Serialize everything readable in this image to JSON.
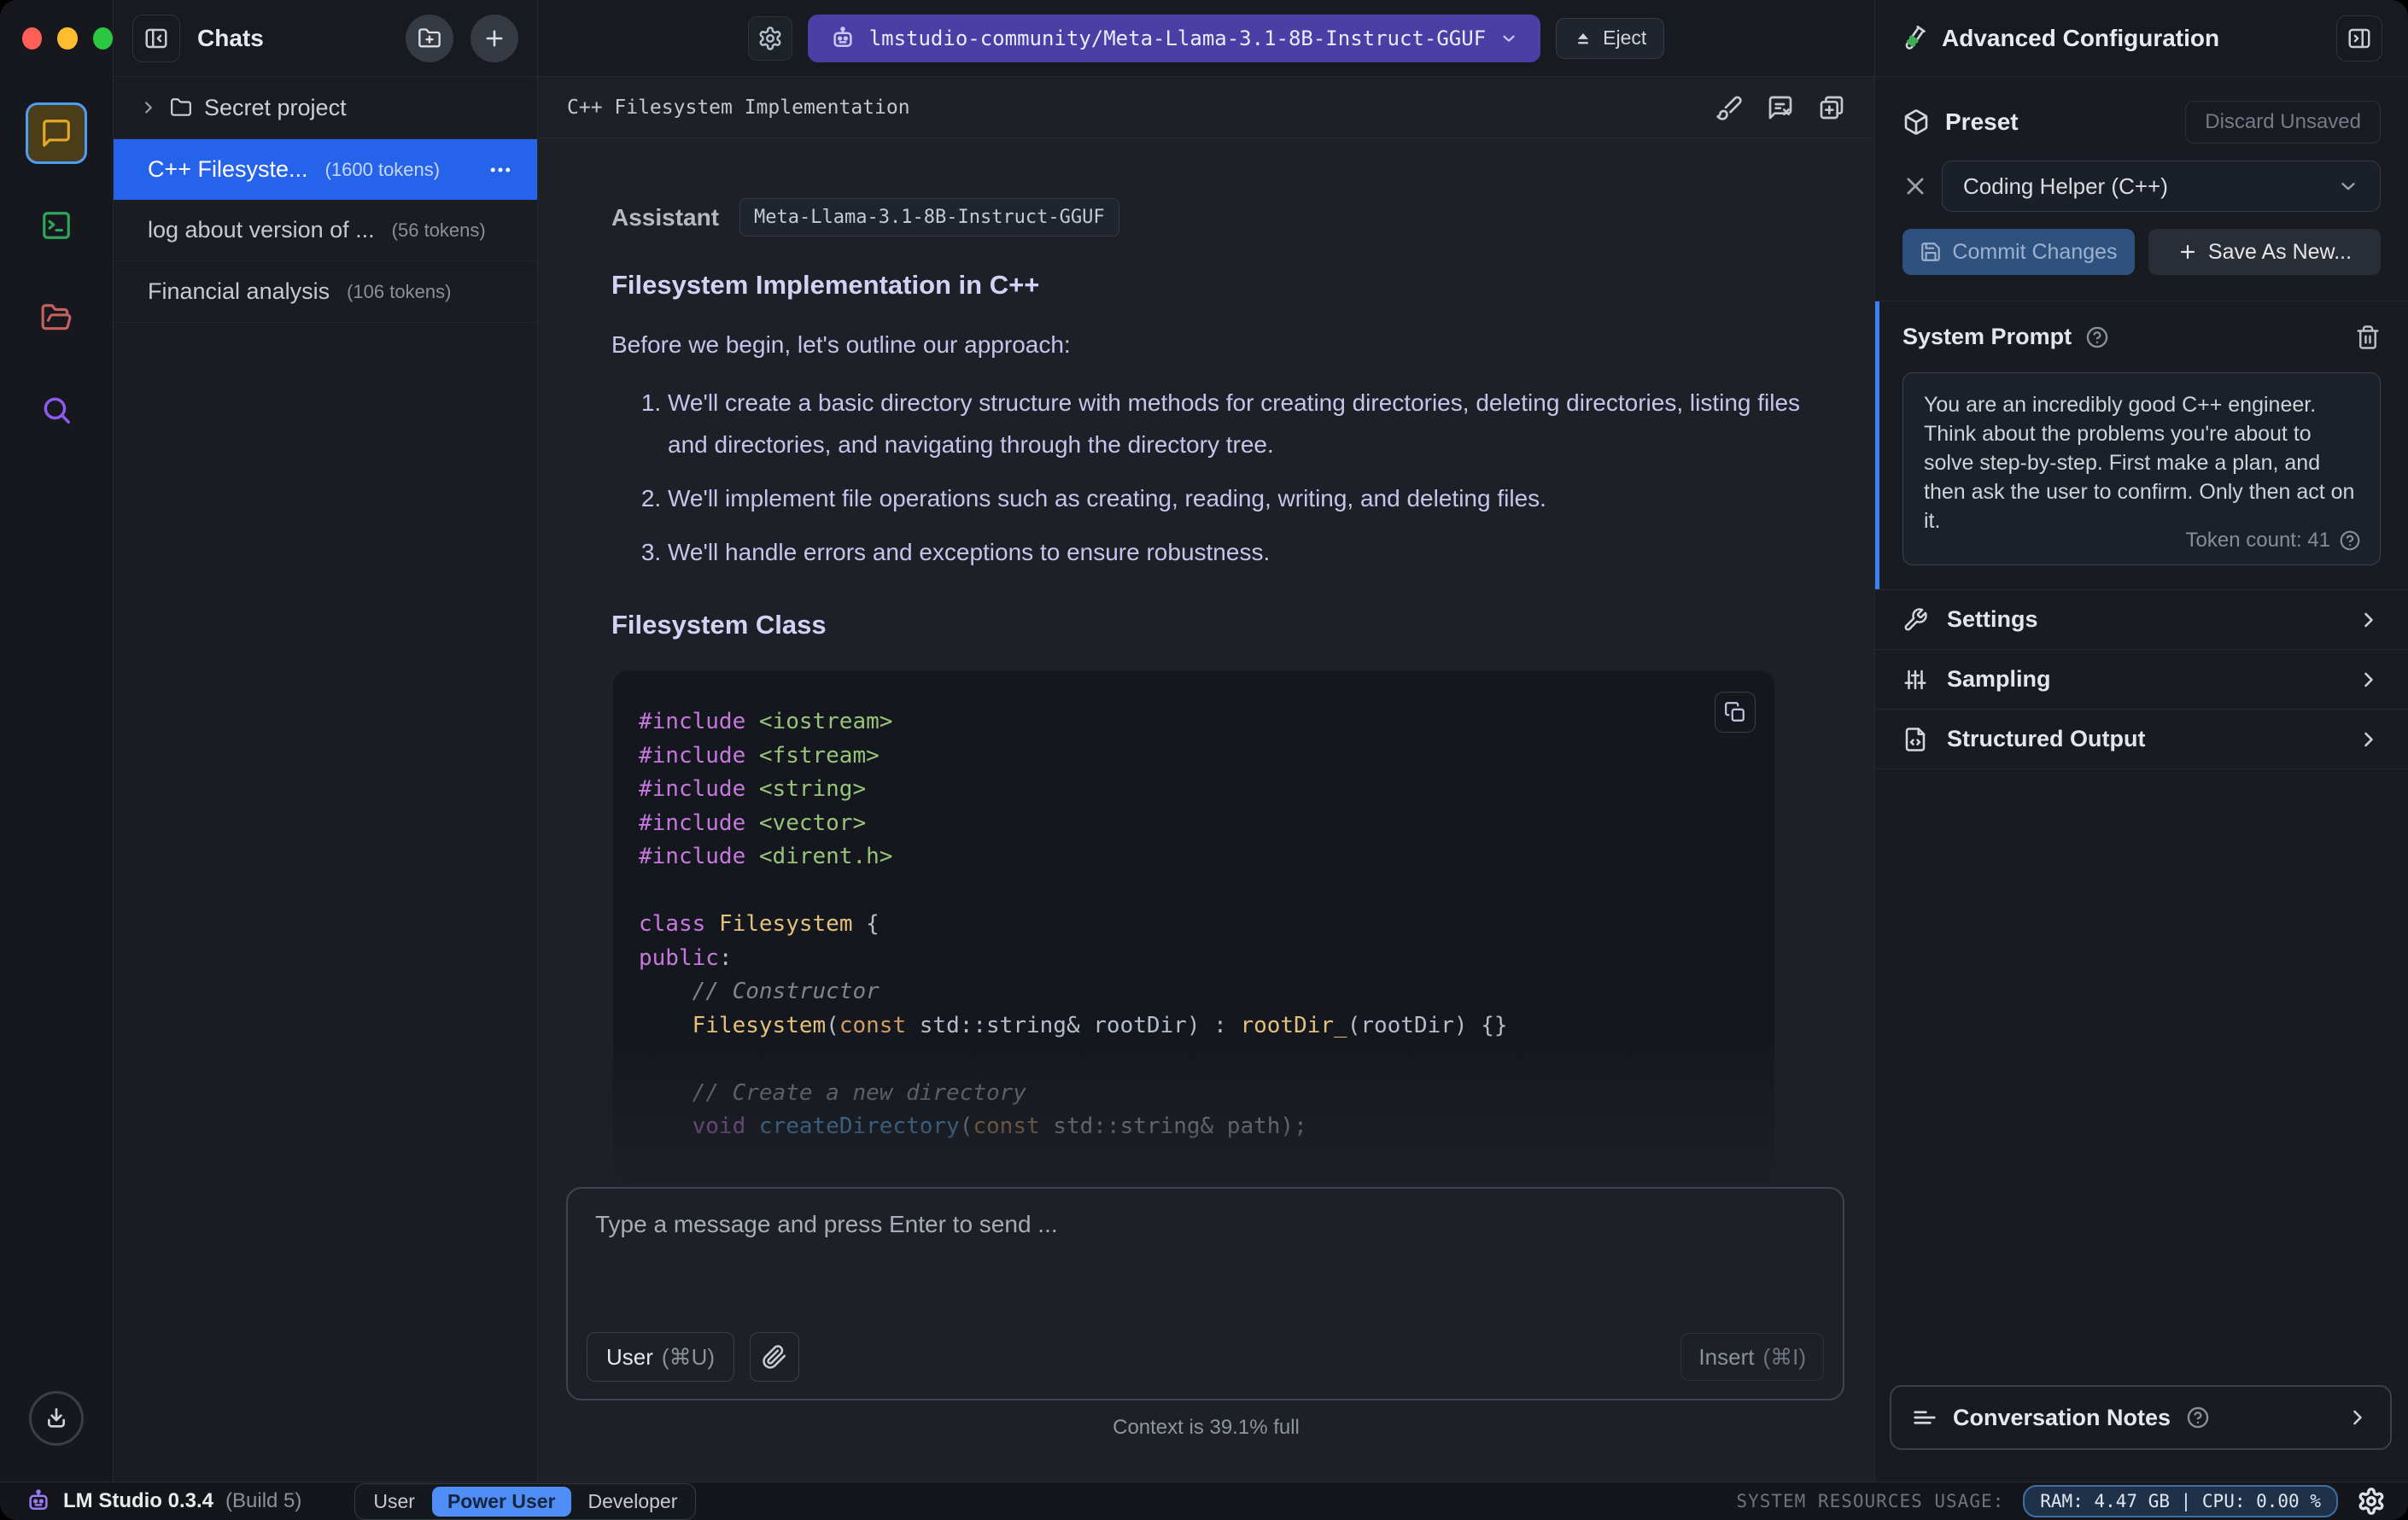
{
  "topbar": {
    "model": "lmstudio-community/Meta-Llama-3.1-8B-Instruct-GGUF",
    "eject_label": "Eject"
  },
  "sidebar": {
    "title": "Chats",
    "folder_name": "Secret project",
    "chats": [
      {
        "name": "C++ Filesyste...",
        "tokens": "(1600 tokens)"
      },
      {
        "name": "log about version of ...",
        "tokens": "(56 tokens)"
      },
      {
        "name": "Financial analysis",
        "tokens": "(106 tokens)"
      }
    ]
  },
  "chat": {
    "title": "C++ Filesystem Implementation",
    "assistant_label": "Assistant",
    "model_badge": "Meta-Llama-3.1-8B-Instruct-GGUF",
    "heading1": "Filesystem Implementation in C++",
    "intro": "Before we begin, let's outline our approach:",
    "list": [
      "We'll create a basic directory structure with methods for creating directories, deleting directories, listing files and directories, and navigating through the directory tree.",
      "We'll implement file operations such as creating, reading, writing, and deleting files.",
      "We'll handle errors and exceptions to ensure robustness."
    ],
    "heading2": "Filesystem Class",
    "code_lines": [
      [
        [
          "mg",
          "#include"
        ],
        [
          "pl",
          " "
        ],
        [
          "str",
          "<iostream>"
        ]
      ],
      [
        [
          "mg",
          "#include"
        ],
        [
          "pl",
          " "
        ],
        [
          "str",
          "<fstream>"
        ]
      ],
      [
        [
          "mg",
          "#include"
        ],
        [
          "pl",
          " "
        ],
        [
          "str",
          "<string>"
        ]
      ],
      [
        [
          "mg",
          "#include"
        ],
        [
          "pl",
          " "
        ],
        [
          "str",
          "<vector>"
        ]
      ],
      [
        [
          "mg",
          "#include"
        ],
        [
          "pl",
          " "
        ],
        [
          "str",
          "<dirent.h>"
        ]
      ],
      [],
      [
        [
          "mg",
          "class"
        ],
        [
          "pl",
          " "
        ],
        [
          "ty",
          "Filesystem"
        ],
        [
          "pl",
          " {"
        ]
      ],
      [
        [
          "mg",
          "public"
        ],
        [
          "pl",
          ":"
        ]
      ],
      [
        [
          "pl",
          "    "
        ],
        [
          "cm",
          "// Constructor"
        ]
      ],
      [
        [
          "pl",
          "    "
        ],
        [
          "ty",
          "Filesystem"
        ],
        [
          "pl",
          "("
        ],
        [
          "or",
          "const"
        ],
        [
          "pl",
          " std::string& rootDir) : "
        ],
        [
          "ty",
          "rootDir_"
        ],
        [
          "pl",
          "(rootDir) {}"
        ]
      ],
      [],
      [
        [
          "pl",
          "    "
        ],
        [
          "cm",
          "// Create a new directory"
        ]
      ],
      [
        [
          "pl",
          "    "
        ],
        [
          "mg",
          "void"
        ],
        [
          "pl",
          " "
        ],
        [
          "fn",
          "createDirectory"
        ],
        [
          "pl",
          "("
        ],
        [
          "or",
          "const"
        ],
        [
          "pl",
          " std::string& path);"
        ]
      ]
    ],
    "input_placeholder": "Type a message and press Enter to send ...",
    "user_button": "User",
    "user_shortcut": "(⌘U)",
    "insert_label": "Insert",
    "insert_shortcut": "(⌘I)",
    "context_status": "Context is 39.1% full"
  },
  "right_panel": {
    "title": "Advanced Configuration",
    "preset": {
      "label": "Preset",
      "discard": "Discard Unsaved",
      "value": "Coding Helper (C++)",
      "commit": "Commit Changes",
      "save_new": "Save As New..."
    },
    "system_prompt": {
      "label": "System Prompt",
      "text": "You are an incredibly good C++ engineer. Think about the problems you're about to solve step-by-step. First make a plan, and then ask the user to confirm. Only then act on it.",
      "token_count": "Token count: 41"
    },
    "sections": [
      {
        "label": "Settings"
      },
      {
        "label": "Sampling"
      },
      {
        "label": "Structured Output"
      }
    ],
    "notes_label": "Conversation Notes"
  },
  "status_bar": {
    "app": "LM Studio 0.3.4",
    "build": "(Build 5)",
    "modes": [
      "User",
      "Power User",
      "Developer"
    ],
    "active_mode": "Power User",
    "resources_label": "SYSTEM RESOURCES USAGE:",
    "resources_value": "RAM: 4.47 GB  |  CPU: 0.00 %"
  },
  "colors": {
    "accent_blue": "#2563eb",
    "mode_blue": "#4f8ef7",
    "model_pill_indigo": "#4b3fa5",
    "system_prompt_accent": "#3b82f6",
    "lavender_text": "#c7c4ec",
    "chat_icon_yellow": "#e2a92b",
    "terminal_icon_green": "#2fa45c",
    "folder_icon_red": "#c4605f",
    "search_icon_purple": "#8e5bf0",
    "logo_purple": "#9b7bf3"
  }
}
